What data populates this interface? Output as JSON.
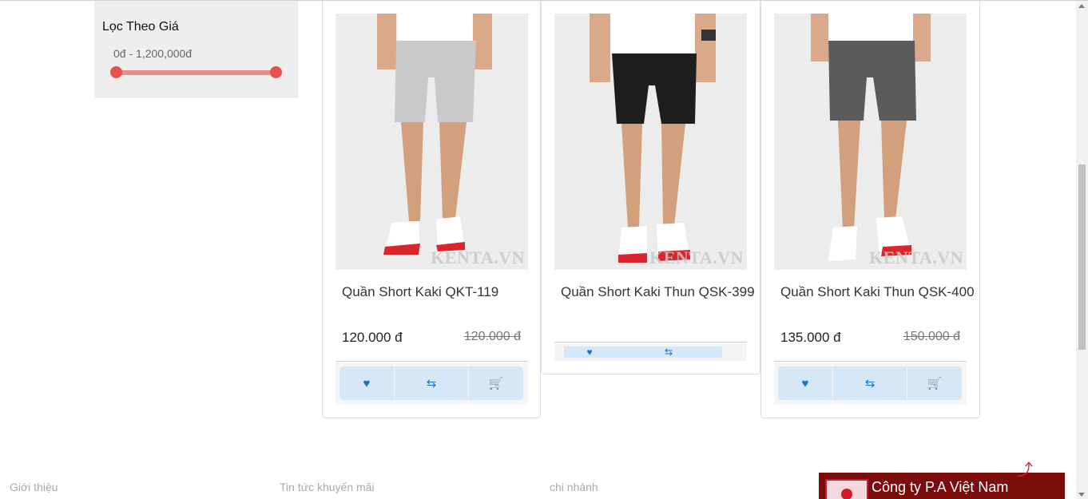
{
  "filter": {
    "title": "Lọc Theo Giá",
    "range_text": "0đ - 1,200,000đ",
    "slider_min_value": 0,
    "slider_max_value": 1200000,
    "color": "#e9514c"
  },
  "products": [
    {
      "name": "Quần Short Kaki QKT-119",
      "price": "120.000 đ",
      "old_price": "120.000 đ",
      "watermark": "KENTA.VN",
      "shorts_color": "#c9c9c9",
      "actions": [
        "heart-icon",
        "compare-icon",
        "cart-icon"
      ]
    },
    {
      "name": "Quần Short Kaki Thun QSK-399",
      "price": "",
      "old_price": "",
      "watermark": "KENTA.VN",
      "shorts_color": "#1e1e1e",
      "actions": [
        "heart-icon",
        "compare-icon"
      ]
    },
    {
      "name": "Quần Short Kaki Thun QSK-400",
      "price": "135.000 đ",
      "old_price": "150.000 đ",
      "watermark": "KENTA.VN",
      "shorts_color": "#5b5b5b",
      "actions": [
        "heart-icon",
        "compare-icon",
        "cart-icon"
      ]
    }
  ],
  "footer": {
    "links": [
      "Giới thiệu",
      "Tin tức khuyến mãi",
      "chi nhánh"
    ],
    "fb_banner_title": "Công ty P.A Việt Nam"
  },
  "colors": {
    "accent_blue": "#1a73c1",
    "action_bg": "#d6e8f7",
    "banner_bg": "#7a0c0c"
  }
}
